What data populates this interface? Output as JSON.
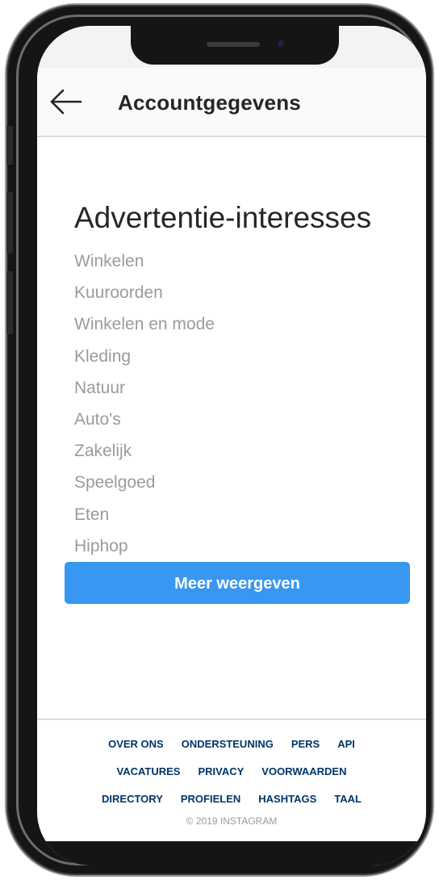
{
  "header": {
    "back_icon": "arrow-left-icon",
    "title": "Accountgegevens"
  },
  "section": {
    "title": "Advertentie-interesses"
  },
  "interests": [
    "Winkelen",
    "Kuuroorden",
    "Winkelen en mode",
    "Kleding",
    "Natuur",
    "Auto's",
    "Zakelijk",
    "Speelgoed",
    "Eten",
    "Hiphop"
  ],
  "more_button": {
    "label": "Meer weergeven",
    "color": "#3897f0"
  },
  "footer": {
    "rows": [
      [
        "OVER ONS",
        "ONDERSTEUNING",
        "PERS",
        "API"
      ],
      [
        "VACATURES",
        "PRIVACY",
        "VOORWAARDEN"
      ],
      [
        "DIRECTORY",
        "PROFIELEN",
        "HASHTAGS",
        "TAAL"
      ]
    ],
    "link_color": "#003569",
    "copyright": "© 2019 INSTAGRAM"
  }
}
